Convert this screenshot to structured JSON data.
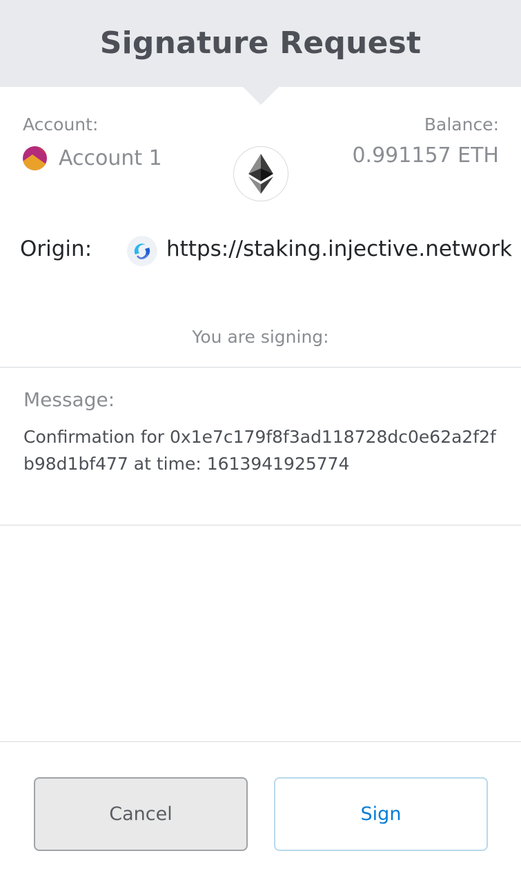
{
  "header": {
    "title": "Signature Request"
  },
  "account": {
    "label": "Account:",
    "name": "Account 1"
  },
  "balance": {
    "label": "Balance:",
    "value": "0.991157 ETH"
  },
  "origin": {
    "label": "Origin:",
    "url": "https://staking.injective.network",
    "icon": "injective-logo-icon"
  },
  "network": {
    "icon": "ethereum-icon"
  },
  "signing": {
    "label": "You are signing:"
  },
  "message": {
    "label": "Message:",
    "text": "Confirmation for 0x1e7c179f8f3ad118728dc0e62a2f2fb98d1bf477 at time: 1613941925774"
  },
  "buttons": {
    "cancel_label": "Cancel",
    "sign_label": "Sign"
  },
  "colors": {
    "header_bg": "#e8eaed",
    "sign_text": "#037dd6",
    "sign_border": "#b8d9ed",
    "cancel_bg": "#e9e9e9",
    "avatar_primary": "#b32b7a",
    "avatar_secondary": "#e9a12a"
  }
}
